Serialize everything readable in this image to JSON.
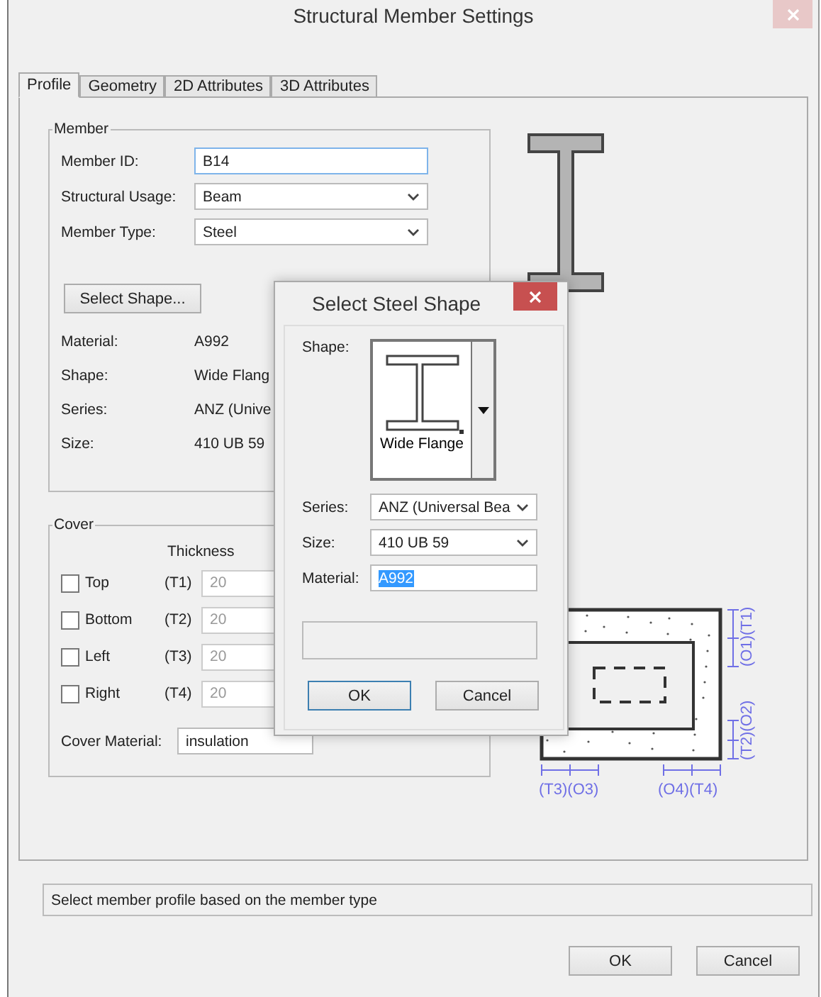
{
  "window": {
    "title": "Structural Member Settings"
  },
  "tabs": [
    {
      "label": "Profile",
      "selected": true
    },
    {
      "label": "Geometry",
      "selected": false
    },
    {
      "label": "2D Attributes",
      "selected": false
    },
    {
      "label": "3D Attributes",
      "selected": false
    }
  ],
  "member": {
    "title": "Member",
    "fields": [
      {
        "kind": "input",
        "label": "Member ID:",
        "value": "B14",
        "focused": true
      },
      {
        "kind": "select",
        "label": "Structural Usage:",
        "value": "Beam",
        "focused": false
      },
      {
        "kind": "select",
        "label": "Member Type:",
        "value": "Steel",
        "focused": false
      }
    ],
    "select_shape_button": "Select Shape...",
    "info": [
      {
        "label": "Material:",
        "value": "A992"
      },
      {
        "label": "Shape:",
        "value": "Wide Flang"
      },
      {
        "label": "Series:",
        "value": "ANZ (Unive"
      },
      {
        "label": "Size:",
        "value": "410 UB 59"
      }
    ]
  },
  "cover": {
    "title": "Cover",
    "column_heading": "Thickness",
    "sides": [
      {
        "label": "Top",
        "code": "(T1)",
        "value": "20",
        "checked": false,
        "disabled": true
      },
      {
        "label": "Bottom",
        "code": "(T2)",
        "value": "20",
        "checked": false,
        "disabled": true
      },
      {
        "label": "Left",
        "code": "(T3)",
        "value": "20",
        "checked": false,
        "disabled": true
      },
      {
        "label": "Right",
        "code": "(T4)",
        "value": "20",
        "checked": false,
        "disabled": true
      }
    ],
    "material_label": "Cover Material:",
    "material": "insulation"
  },
  "cover_diagram": {
    "top": "(O1)(T1)",
    "bottom": "(T2)(O2)",
    "left": "(T3)(O3)",
    "right": "(O4)(T4)"
  },
  "status": "Select member profile based on the member type",
  "buttons": [
    {
      "label": "OK"
    },
    {
      "label": "Cancel"
    }
  ],
  "dialog": {
    "title": "Select Steel Shape",
    "shape_label": "Shape:",
    "shape_name": "Wide Flange",
    "fields": [
      {
        "kind": "select",
        "label": "Series:",
        "value": "ANZ (Universal Bea",
        "selected": false
      },
      {
        "kind": "select",
        "label": "Size:",
        "value": "410 UB 59",
        "selected": false
      },
      {
        "kind": "input",
        "label": "Material:",
        "value": "A992",
        "selected": true
      }
    ],
    "buttons": [
      {
        "label": "OK",
        "default": true
      },
      {
        "label": "Cancel",
        "default": false
      }
    ]
  }
}
